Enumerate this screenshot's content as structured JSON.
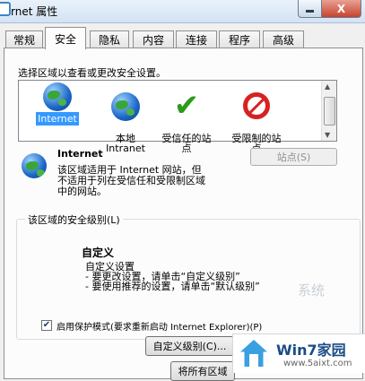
{
  "window": {
    "title": "rnet 属性",
    "close_glyph": "X"
  },
  "tabs": [
    "常规",
    "安全",
    "隐私",
    "内容",
    "连接",
    "程序",
    "高级"
  ],
  "active_tab": "安全",
  "zones": {
    "instruction": "选择区域以查看或更改安全设置。",
    "items": [
      {
        "label": "Internet",
        "icon": "internet-globe-icon"
      },
      {
        "label": "本地\nIntranet",
        "icon": "intranet-globe-icon"
      },
      {
        "label": "受信任的站\n点",
        "icon": "green-check-icon"
      },
      {
        "label": "受限制的站\n点",
        "icon": "no-entry-icon"
      }
    ]
  },
  "zone_info": {
    "title": "Internet",
    "description_lines": [
      "该区域适用于 Internet 网站，但",
      "不适用于列在受信任和受限制区域",
      "中的网站。"
    ],
    "sites_button": "站点(S)"
  },
  "security_level": {
    "group_title": "该区域的安全级别(L)",
    "level_name": "自定义",
    "lines": [
      "自定义设置",
      "- 要更改设置，请单击“自定义级别”",
      "- 要使用推荐的设置，请单击“默认级别”"
    ]
  },
  "protected_mode": {
    "checked": true,
    "label": "启用保护模式(要求重新启动 Internet Explorer)(P)"
  },
  "buttons": {
    "custom_level": "自定义级别(C)...",
    "reset_all": "将所有区域"
  },
  "watermark": {
    "brand": "Win7家园",
    "url": "www.5aixt.com",
    "faded_text": "系统"
  },
  "colors": {
    "selection": "#3399ff",
    "close_button": "#c7432d"
  }
}
